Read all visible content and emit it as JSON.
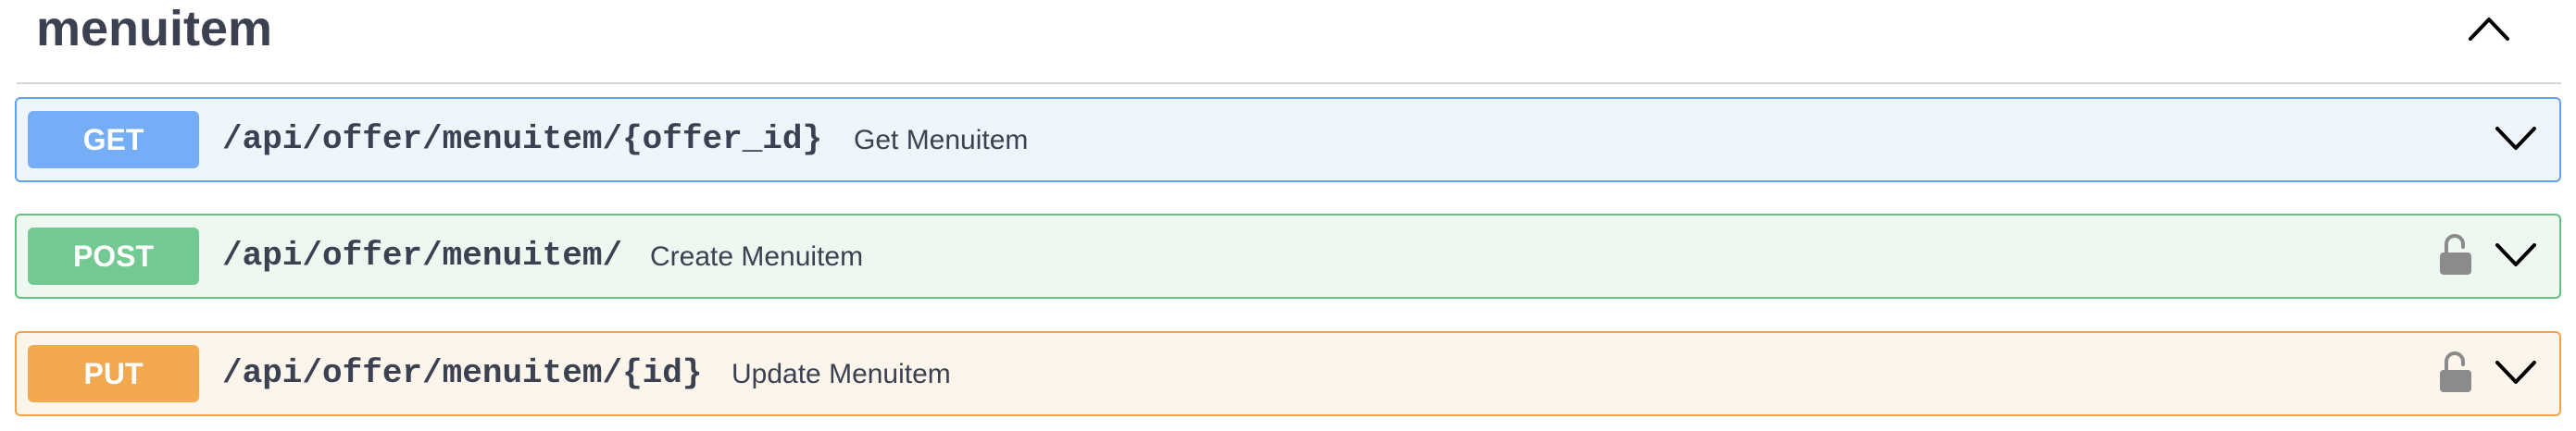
{
  "section": {
    "title": "menuitem",
    "toggle_icon": "chevron-up-icon"
  },
  "operations": [
    {
      "method": "GET",
      "path": "/api/offer/menuitem/{offer_id}",
      "summary": "Get Menuitem",
      "locked": false,
      "color": "#61affe"
    },
    {
      "method": "POST",
      "path": "/api/offer/menuitem/",
      "summary": "Create Menuitem",
      "locked": true,
      "color": "#49cc90"
    },
    {
      "method": "PUT",
      "path": "/api/offer/menuitem/{id}",
      "summary": "Update Menuitem",
      "locked": true,
      "color": "#fca130"
    }
  ]
}
